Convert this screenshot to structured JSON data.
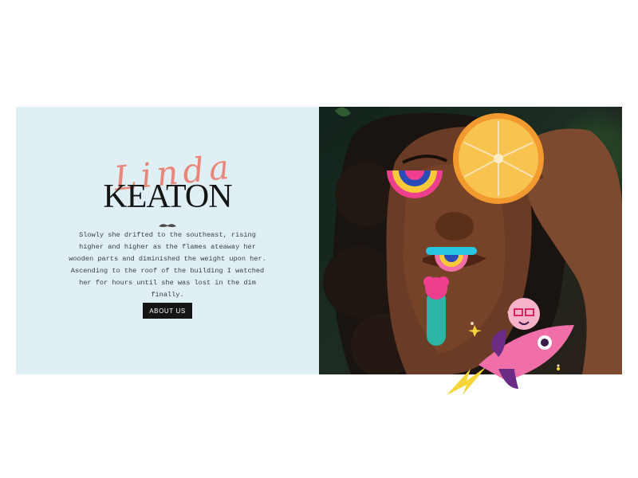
{
  "hero": {
    "script_name": "Linda",
    "main_name": "KEATON",
    "bio": "Slowly she drifted to the southeast, rising higher and higher as the flames ateaway her wooden parts and diminished the weight upon her. Ascending to the roof of the building I watched her for hours until she was lost in the dim finally.",
    "cta_label": "ABOUT US"
  },
  "colors": {
    "panel_bg": "#e0eff4",
    "script_accent": "#e9867a",
    "button_bg": "#151515",
    "text_dark": "#151515"
  },
  "icons": {
    "divider": "mustache-divider-icon",
    "decor": [
      "rainbow-sticker-left",
      "rainbow-sticker-mouth",
      "cactus-sticker",
      "rocket-sticker"
    ]
  }
}
